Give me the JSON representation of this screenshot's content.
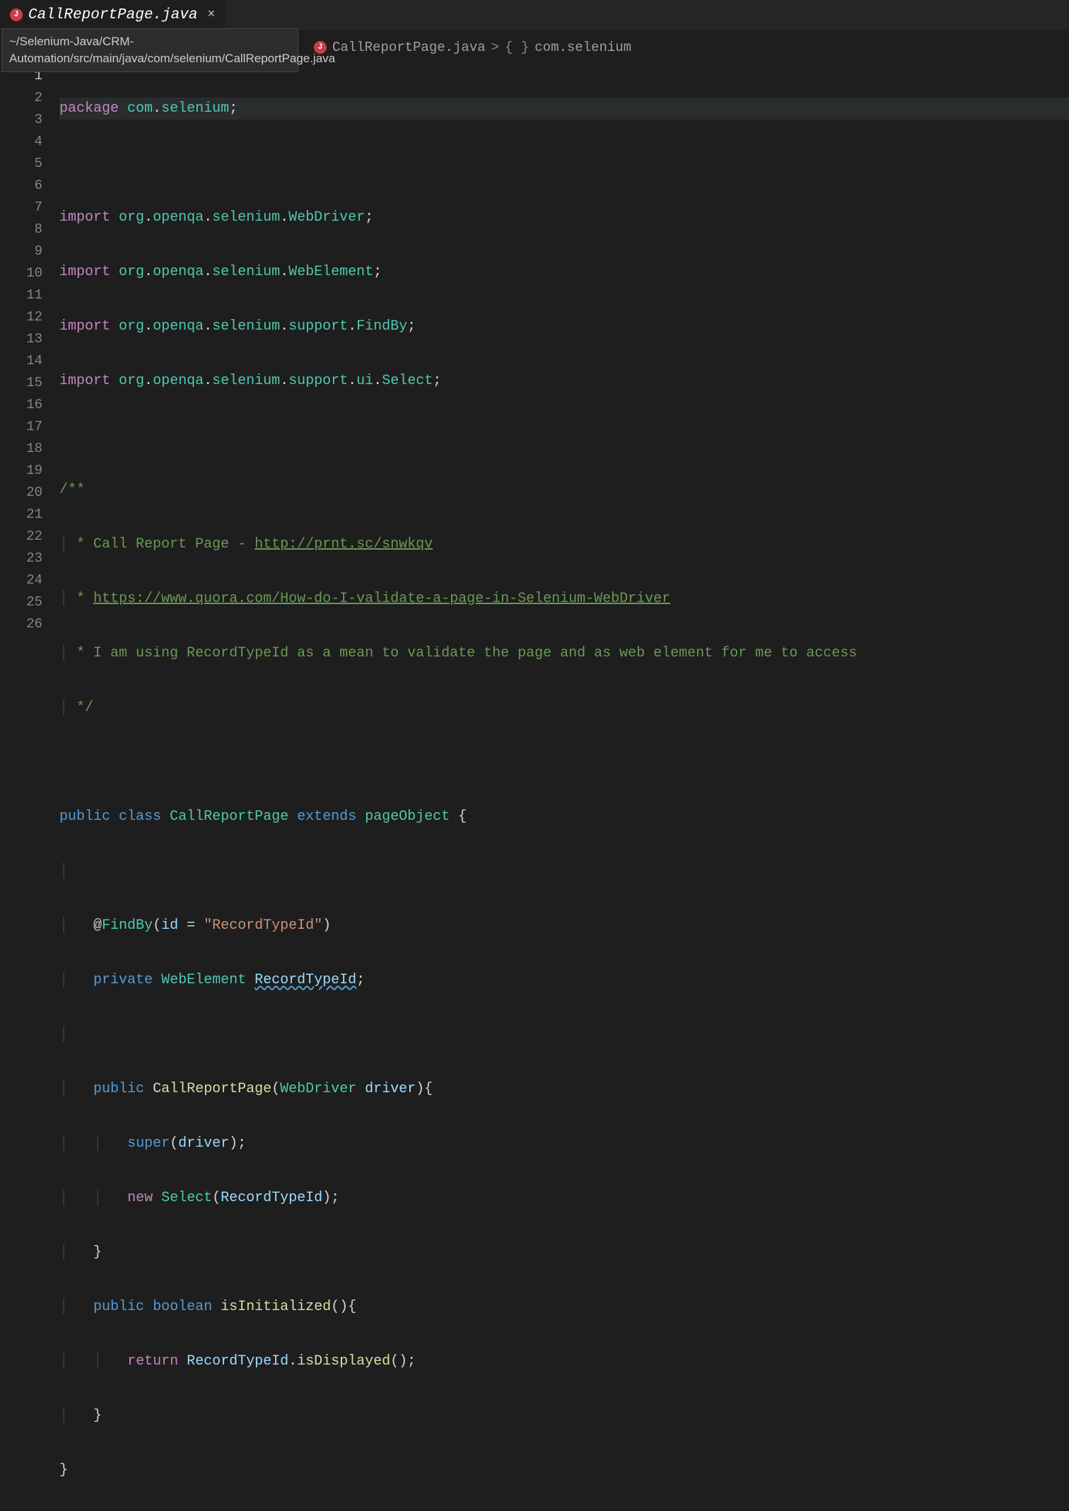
{
  "tab": {
    "label": "CallReportPage.java",
    "icon": "J",
    "close": "×"
  },
  "tooltip": "~/Selenium-Java/CRM-Automation/src/main/java/com/selenium/CallReportPage.java",
  "breadcrumb": {
    "file": "CallReportPage.java",
    "sep": ">",
    "ns_icon": "{ }",
    "namespace": "com.selenium"
  },
  "lines": [
    "1",
    "2",
    "3",
    "4",
    "5",
    "6",
    "7",
    "8",
    "9",
    "10",
    "11",
    "12",
    "13",
    "14",
    "15",
    "16",
    "17",
    "18",
    "19",
    "20",
    "21",
    "22",
    "23",
    "24",
    "25",
    "26"
  ],
  "code": {
    "l1_package": "package",
    "l1_pkg": "com",
    "l1_dot": ".",
    "l1_pkg2": "selenium",
    "l1_semi": ";",
    "import": "import",
    "l3": {
      "p1": "org",
      "p2": "openqa",
      "p3": "selenium",
      "cls": "WebDriver"
    },
    "l4": {
      "p1": "org",
      "p2": "openqa",
      "p3": "selenium",
      "cls": "WebElement"
    },
    "l5": {
      "p1": "org",
      "p2": "openqa",
      "p3": "selenium",
      "p4": "support",
      "cls": "FindBy"
    },
    "l6": {
      "p1": "org",
      "p2": "openqa",
      "p3": "selenium",
      "p4": "support",
      "p5": "ui",
      "cls": "Select"
    },
    "c_open": "/**",
    "c_star": " * ",
    "c9_text": "Call Report Page - ",
    "c9_link": "http://prnt.sc/snwkqv",
    "c10_link": "https://www.quora.com/How-do-I-validate-a-page-in-Selenium-WebDriver",
    "c11_text": "I am using RecordTypeId as a mean to validate the page and as web element for me to access",
    "c_close": " */",
    "l14": {
      "public": "public",
      "class": "class",
      "name": "CallReportPage",
      "extends": "extends",
      "parent": "pageObject",
      "brace": " {"
    },
    "l16": {
      "at": "@",
      "ann": "FindBy",
      "open": "(",
      "id": "id",
      "eq": " = ",
      "str": "\"RecordTypeId\"",
      "close": ")"
    },
    "l17": {
      "private": "private",
      "type": "WebElement",
      "name": "RecordTypeId",
      "semi": ";"
    },
    "l19": {
      "public": "public",
      "ctor": "CallReportPage",
      "open": "(",
      "ptype": "WebDriver",
      "pname": "driver",
      "close": "){"
    },
    "l20": {
      "super": "super",
      "open": "(",
      "arg": "driver",
      "close": ");"
    },
    "l21": {
      "new": "new",
      "cls": "Select",
      "open": "(",
      "arg": "RecordTypeId",
      "close": ");"
    },
    "l22_close": "}",
    "l23": {
      "public": "public",
      "ret": "boolean",
      "name": "isInitialized",
      "paren": "(){"
    },
    "l24": {
      "return": "return",
      "obj": "RecordTypeId",
      "dot": ".",
      "method": "isDisplayed",
      "paren": "();"
    },
    "l25_close": "}",
    "l26_close": "}"
  }
}
